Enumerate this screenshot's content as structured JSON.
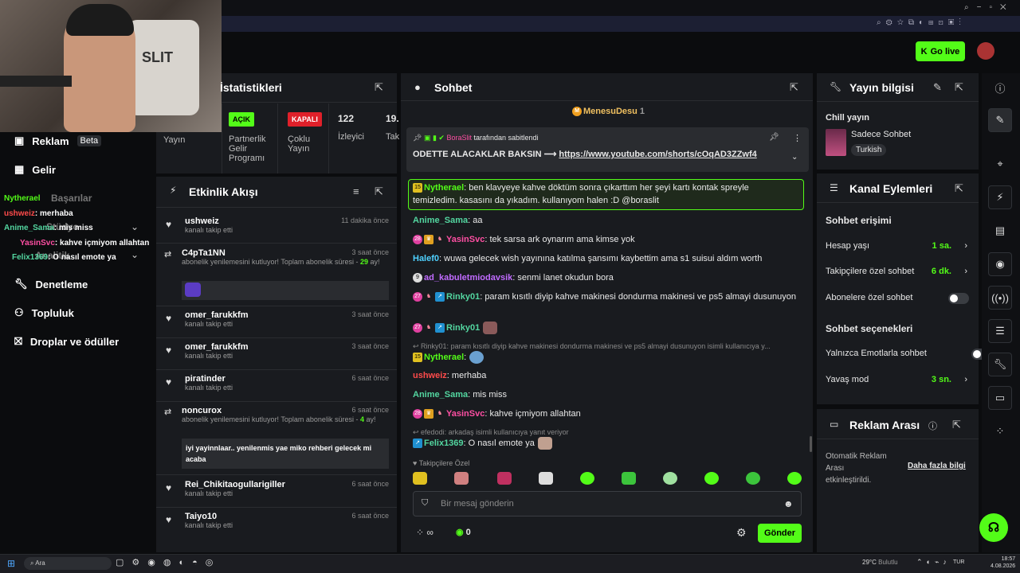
{
  "browser": {
    "title_bar_color": "#1c1f33"
  },
  "header": {
    "go_live": "Go live"
  },
  "sidebar": {
    "items": [
      {
        "label": "Reklam",
        "badge": "Beta"
      },
      {
        "label": "Gelir"
      },
      {
        "label": "Denetleme"
      },
      {
        "label": "Topluluk"
      },
      {
        "label": "Droplar ve ödüller"
      }
    ],
    "overlay_chat": [
      {
        "user": "Nytherael",
        "text": ""
      },
      {
        "user": "ushweiz",
        "text": ": merhaba"
      },
      {
        "user": "Anime_Sama",
        "text": ": mis miss"
      },
      {
        "user": "YasinSvc",
        "text": ": kahve içmiyom allahtan"
      },
      {
        "user": "Felix1369",
        "text": ": O nasıl emote ya"
      }
    ],
    "hidden_items": [
      "Başarılar",
      "Stüdyo",
      "Analitik"
    ]
  },
  "stats": {
    "title": "İstatistikleri",
    "yayin": "Yayın",
    "partner_badge": "AÇIK",
    "partner_label": "Partnerlik Gelir Programı",
    "multi_badge": "KAPALI",
    "multi_label": "Çoklu Yayın",
    "viewers": "122",
    "viewers_label": "İzleyici",
    "cut": "19.",
    "cut_label": "Tak"
  },
  "activity": {
    "title": "Etkinlik Akışı",
    "events": [
      {
        "name": "ushweiz",
        "time": "11 dakika önce",
        "sub": "kanalı takip etti"
      },
      {
        "name": "C4pTa1NN",
        "time": "3 saat önce",
        "sub": "abonelik yenilemesini kutluyor! Toplam abonelik süresi - ",
        "months": "29",
        "tail": "ay!"
      },
      {
        "name": "omer_farukkfm",
        "time": "3 saat önce",
        "sub": "kanalı takip etti"
      },
      {
        "name": "omer_farukkfm",
        "time": "3 saat önce",
        "sub": "kanalı takip etti"
      },
      {
        "name": "piratinder",
        "time": "6 saat önce",
        "sub": "kanalı takip etti"
      },
      {
        "name": "noncurox",
        "time": "6 saat önce",
        "sub": "abonelik yenilemesini kutluyor! Toplam abonelik süresi - ",
        "months": "4",
        "tail": "ay!",
        "message": "iyi yayinnlaar.. yenilenmis yae miko rehberi gelecek mi acaba"
      },
      {
        "name": "Rei_Chikitaogullarigiller",
        "time": "6 saat önce",
        "sub": "kanalı takip etti"
      },
      {
        "name": "Taiyo10",
        "time": "6 saat önce",
        "sub": "kanalı takip etti"
      }
    ]
  },
  "chat": {
    "title": "Sohbet",
    "top_user": "MenesuDesu",
    "top_count": "1",
    "pinned_by_user": "BoraSlit",
    "pinned_by": "tarafından sabitlendi",
    "pinned_text": "ODETTE ALACAKLAR BAKSIN ⟶ ",
    "pinned_link": "https://www.youtube.com/shorts/cOqAD3ZZwf4",
    "messages": [
      {
        "user": "Nytherael",
        "text": ": ben klavyeye kahve döktüm sonra çıkarttım her şeyi kartı kontak spreyle temizledim. kasasını da yıkadım. kullanıyom halen :D @boraslit",
        "color": "#53fc18"
      },
      {
        "user": "Anime_Sama",
        "text": ": aa",
        "color": "#53d6a0"
      },
      {
        "user": "YasinSvc",
        "text": ": tek sarsa ark oynarım ama kimse yok",
        "color": "#ff4fa3"
      },
      {
        "user": "Halef0",
        "text": ": wuwa gelecek wish yayınına katılma şansımı kaybettim ama s1 suisui aldım worth",
        "color": "#4fd1ff"
      },
      {
        "user": "ad_kabuletmiodavsik",
        "text": ": senmi lanet okudun bora",
        "color": "#c06bff"
      },
      {
        "user": "Rinky01",
        "text": ": param kısıtlı diyip kahve makinesi dondurma makinesi ve ps5 almayi dusunuyon",
        "color": "#53d6a0"
      },
      {
        "user": "Rinky01",
        "text": ":",
        "color": "#53d6a0"
      },
      {
        "reply": "Rinky01: param kısıtlı diyip kahve makinesi dondurma makinesi ve ps5 almayi dusunuyon isimli kullanıcıya y..."
      },
      {
        "user": "Nytherael",
        "text": ":",
        "color": "#53fc18"
      },
      {
        "user": "ushweiz",
        "text": ": merhaba",
        "color": "#ff4b4b"
      },
      {
        "user": "Anime_Sama",
        "text": ": mis miss",
        "color": "#53d6a0"
      },
      {
        "user": "YasinSvc",
        "text": ": kahve içmiyom allahtan",
        "color": "#ff4fa3"
      },
      {
        "reply": "efedodi: arkadaş  isimli kullanıcıya yanıt veriyor"
      },
      {
        "user": "Felix1369",
        "text": ": O nasıl emote ya",
        "color": "#53d6a0"
      }
    ],
    "followers_only": "Takipçilere Özel",
    "input_placeholder": "Bir mesaj gönderin",
    "points": "∞",
    "kick_points": "0",
    "send": "Gönder"
  },
  "stream_info": {
    "title": "Yayın bilgisi",
    "stream_title": "Chill yayın",
    "category": "Sadece Sohbet",
    "language": "Turkish"
  },
  "channel_actions": {
    "title": "Kanal Eylemleri",
    "access_title": "Sohbet erişimi",
    "account_age": "Hesap yaşı",
    "account_age_val": "1 sa.",
    "followers_chat": "Takipçilere özel sohbet",
    "followers_chat_val": "6 dk.",
    "subs_chat": "Abonelere özel sohbet",
    "options_title": "Sohbet seçenekleri",
    "emote_only": "Yalnızca Emotlarla sohbet",
    "slow_mode": "Yavaş mod",
    "slow_mode_val": "3 sn."
  },
  "ad_break": {
    "title": "Reklam Arası",
    "text": "Otomatik Reklam Arası etkinleştirildi.",
    "link": "Daha fazla bilgi"
  },
  "taskbar": {
    "search": "Ara",
    "weather": "29°C",
    "weather_sub": "Bulutlu",
    "lang": "TUR",
    "time": "18:57",
    "date": "4.08.2026"
  }
}
